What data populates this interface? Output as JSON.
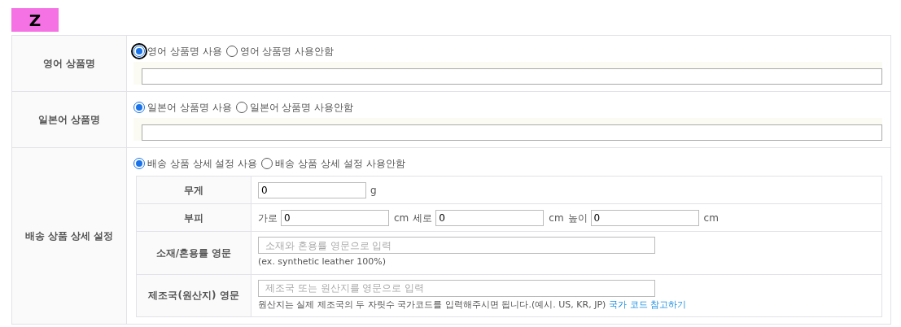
{
  "logo": {
    "text": "Z"
  },
  "rows": [
    {
      "label": "영어 상품명",
      "kind": "name",
      "options": [
        {
          "label": "영어 상품명 사용",
          "selected": true,
          "focused": true
        },
        {
          "label": "영어 상품명 사용안함",
          "selected": false,
          "focused": false
        }
      ]
    },
    {
      "label": "일본어 상품명",
      "kind": "name",
      "options": [
        {
          "label": "일본어 상품명 사용",
          "selected": true,
          "focused": false
        },
        {
          "label": "일본어 상품명 사용안함",
          "selected": false,
          "focused": false
        }
      ]
    },
    {
      "label": "배송 상품 상세 설정",
      "kind": "shipping",
      "options": [
        {
          "label": "배송 상품 상세 설정 사용",
          "selected": true,
          "focused": false
        },
        {
          "label": "배송 상품 상세 설정 사용안함",
          "selected": false,
          "focused": false
        }
      ],
      "details": [
        {
          "label": "무게",
          "kind": "weight",
          "value": "0",
          "unit": "g"
        },
        {
          "label": "부피",
          "kind": "volume",
          "parts": [
            {
              "label": "가로",
              "value": "0",
              "unit": "cm"
            },
            {
              "label": "세로",
              "value": "0",
              "unit": "cm"
            },
            {
              "label": "높이",
              "value": "0",
              "unit": "cm"
            }
          ]
        },
        {
          "label": "소재/혼용률 영문",
          "kind": "text",
          "placeholder": "소재와 혼용률 영문으로 입력",
          "note": "(ex. synthetic leather 100%)"
        },
        {
          "label": "제조국(원산지) 영문",
          "kind": "text",
          "placeholder": "제조국 또는 원산지를 영문으로 입력",
          "note": "원산지는 실제 제조국의 두 자릿수 국가코드를 입력해주시면 됩니다.(예시. US, KR, JP)",
          "link": "국가 코드 참고하기"
        }
      ]
    }
  ]
}
